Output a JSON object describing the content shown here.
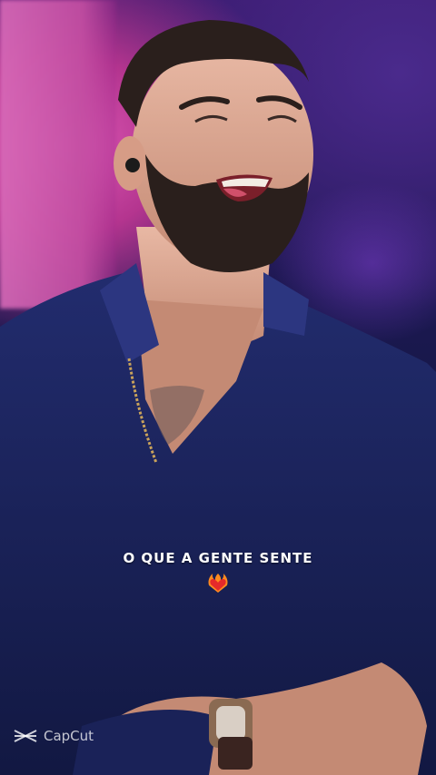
{
  "caption": {
    "text": "O QUE A GENTE SENTE",
    "emoji": "heart-on-fire"
  },
  "watermark": {
    "text": "CapCut",
    "icon": "capcut-logo-icon"
  },
  "colors": {
    "caption_text": "#ffffff",
    "shirt": "#1a2460",
    "background_pink": "#d86ab8",
    "background_purple": "#3a1a6e"
  }
}
